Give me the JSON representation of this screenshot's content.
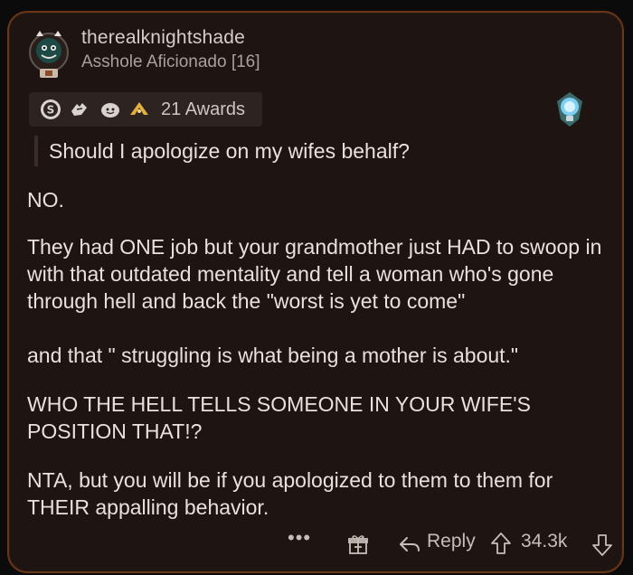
{
  "comment": {
    "username": "therealknightshade",
    "flair": "Asshole Aficionado [16]",
    "awards": {
      "icons": [
        "silver-award-icon",
        "helpful-hand-award-icon",
        "wholesome-award-icon",
        "gold-hat-award-icon"
      ],
      "label": "21 Awards"
    },
    "quote": "Should I apologize on my wifes behalf?",
    "paragraphs": [
      "NO.",
      "They had ONE job but your grandmother just HAD to swoop in with that outdated mentality and tell a woman who's gone through hell and back the \"worst is yet to come\"",
      "and that \" struggling is what being a mother is about.\"",
      "WHO THE HELL TELLS SOMEONE IN YOUR WIFE'S POSITION THAT!?",
      "NTA, but you will be if you apologized to them to them for THEIR appalling behavior."
    ],
    "actions": {
      "more": "•••",
      "reply": "Reply",
      "score": "34.3k"
    }
  },
  "colors": {
    "background": "#1e1412",
    "border": "#6b3618",
    "text": "#e9e1dd",
    "muted": "#a9a09b",
    "award_pill": "#2d2320",
    "bulb": "#3fa8d8"
  }
}
